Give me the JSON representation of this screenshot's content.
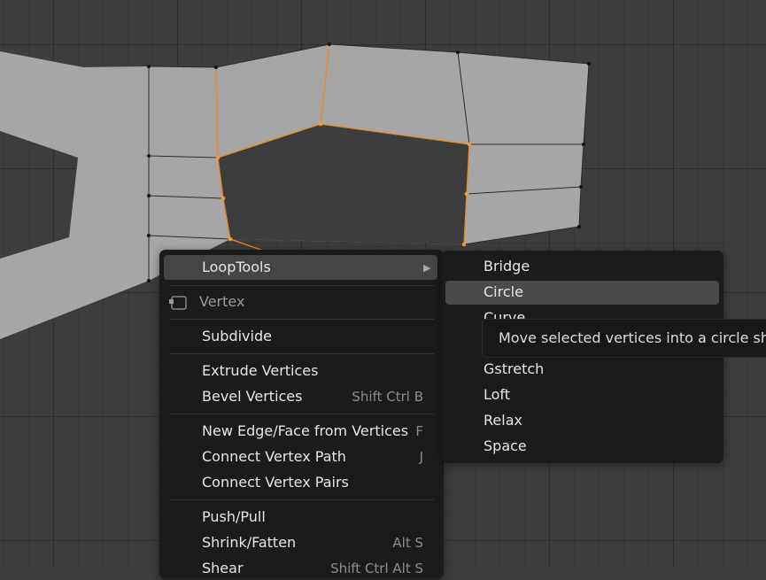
{
  "context_menu": {
    "items": [
      {
        "label": "LoopTools",
        "shortcut": "",
        "highlighted": true,
        "has_submenu": true
      },
      {
        "label": "Vertex",
        "shortcut": "",
        "header": true,
        "icon": "vertex-select-icon"
      },
      {
        "label": "Subdivide",
        "shortcut": ""
      },
      {
        "label": "Extrude Vertices",
        "shortcut": ""
      },
      {
        "label": "Bevel Vertices",
        "shortcut": "Shift Ctrl B"
      },
      {
        "label": "New Edge/Face from Vertices",
        "shortcut": "F"
      },
      {
        "label": "Connect Vertex Path",
        "shortcut": "J"
      },
      {
        "label": "Connect Vertex Pairs",
        "shortcut": ""
      },
      {
        "label": "Push/Pull",
        "shortcut": ""
      },
      {
        "label": "Shrink/Fatten",
        "shortcut": "Alt S"
      },
      {
        "label": "Shear",
        "shortcut": "Shift Ctrl Alt S"
      }
    ]
  },
  "submenu": {
    "title": "LoopTools",
    "items": [
      {
        "label": "Bridge"
      },
      {
        "label": "Circle",
        "highlighted": true
      },
      {
        "label": "Curve"
      },
      {
        "label": "Gstretch"
      },
      {
        "label": "Loft"
      },
      {
        "label": "Relax"
      },
      {
        "label": "Space"
      }
    ]
  },
  "tooltip": {
    "text": "Move selected vertices into a circle shape"
  },
  "colors": {
    "menu_bg": "#1b1b1b",
    "highlight": "#454545",
    "selected_edge": "#f08a1c",
    "mesh_face": "#a6a6a6",
    "viewport_bg": "#3d3d3d"
  }
}
